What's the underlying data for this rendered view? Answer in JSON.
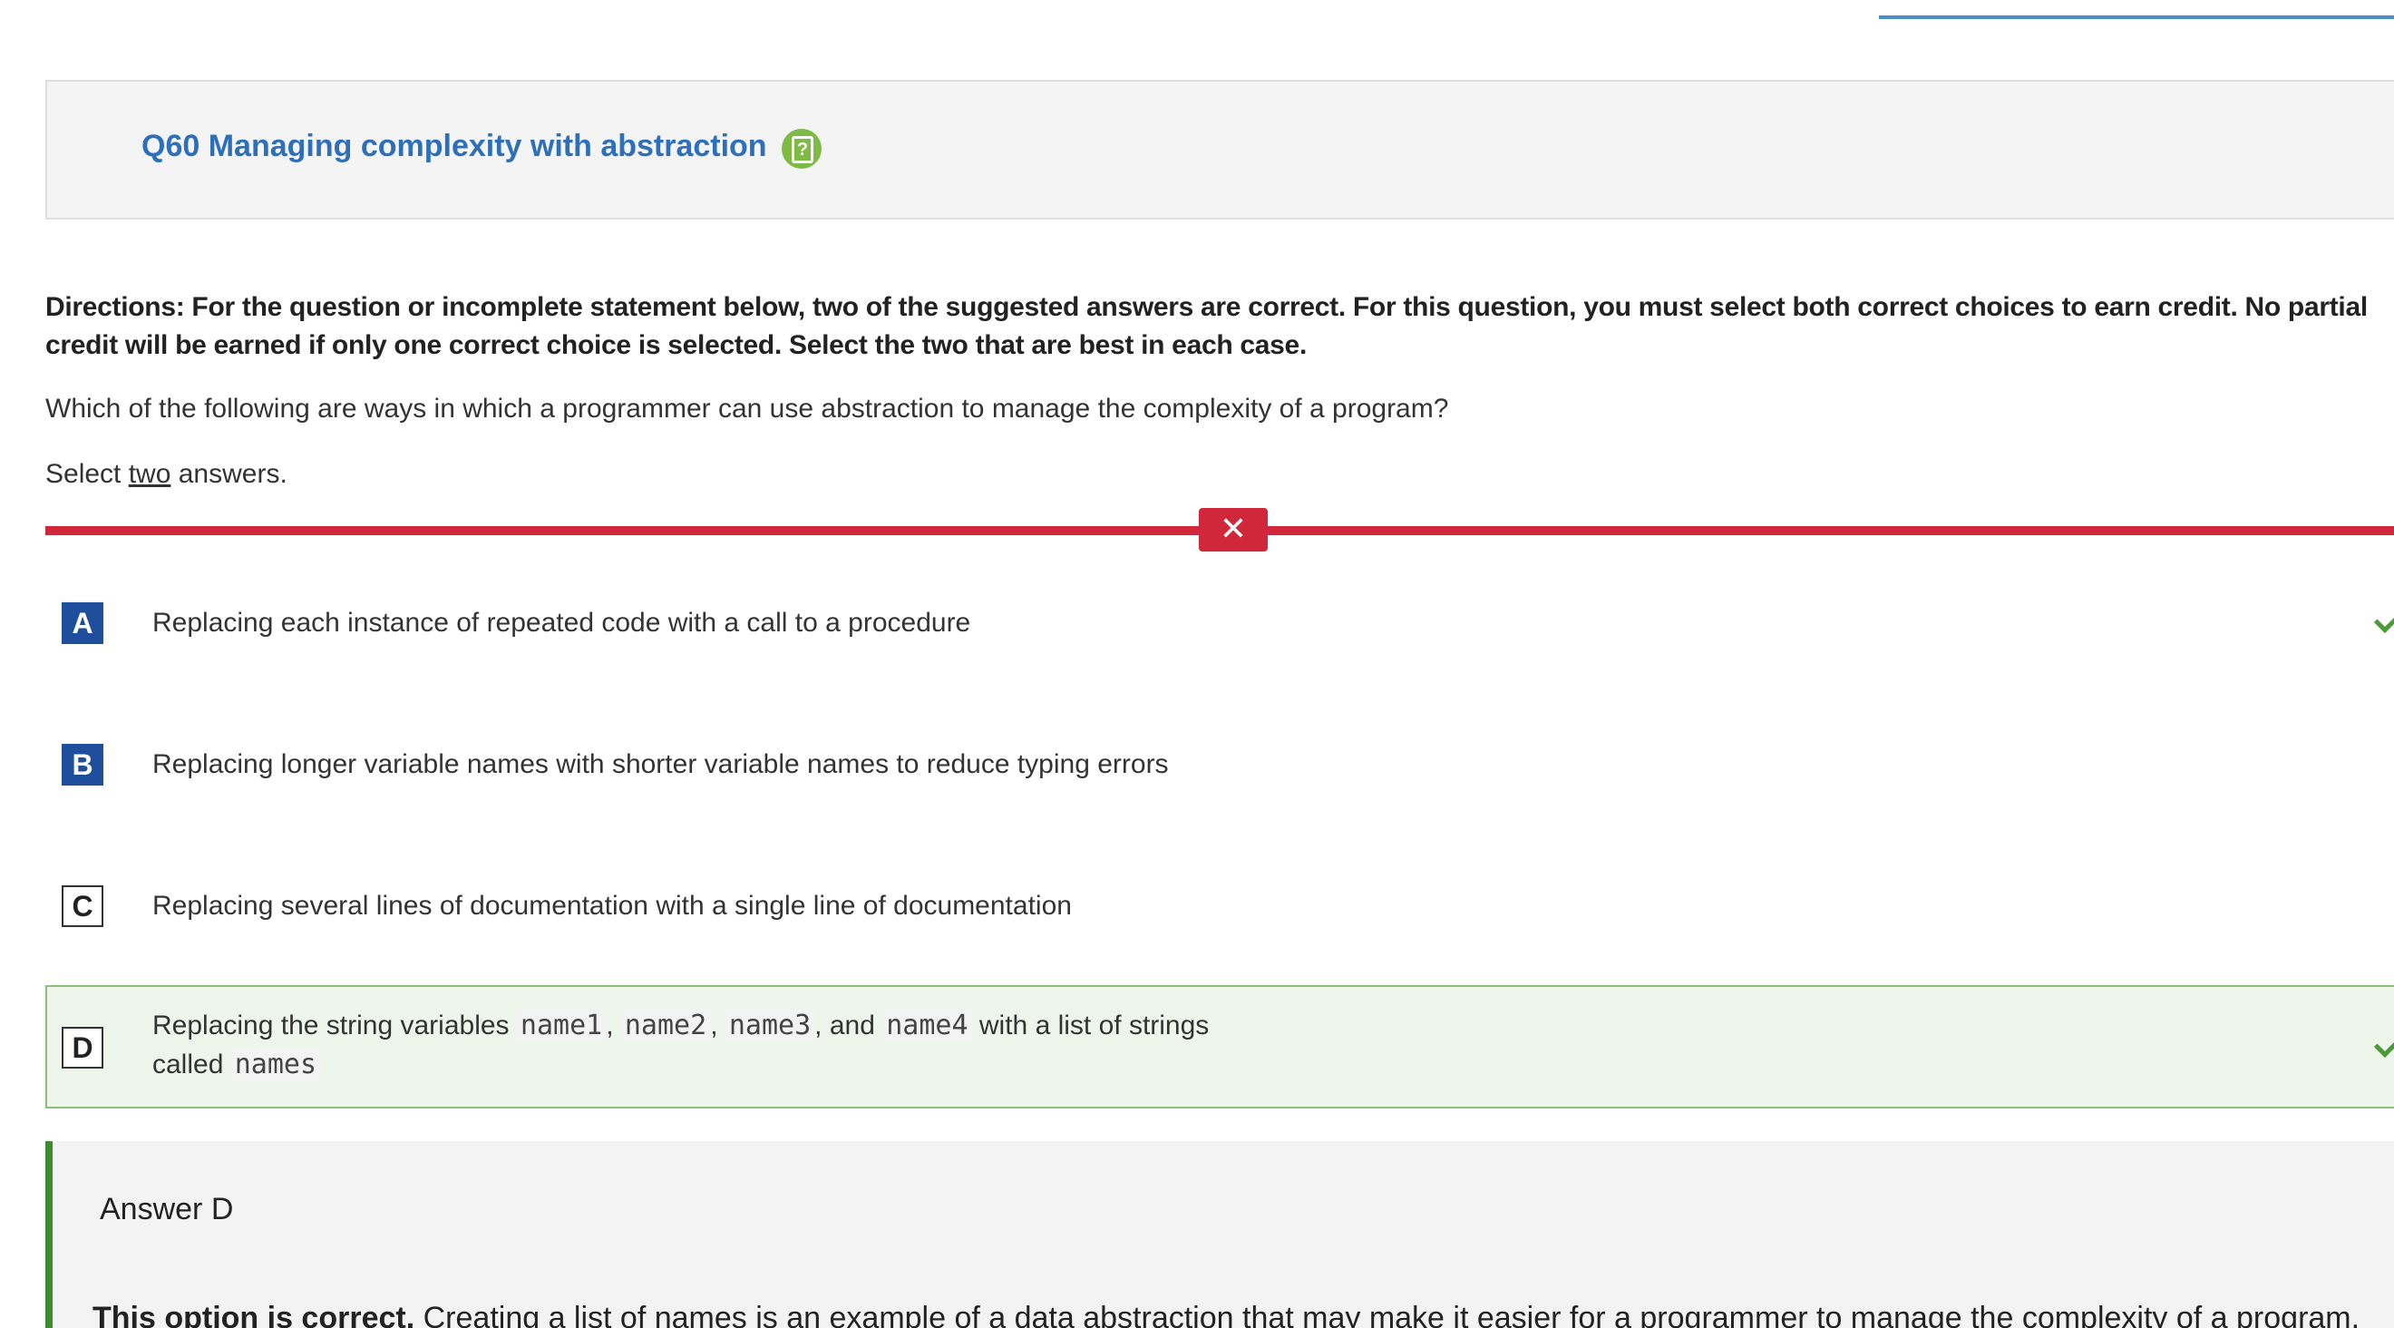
{
  "question": {
    "title": "Q60 Managing complexity with abstraction",
    "help_icon": "help-icon",
    "directions": "Directions: For the question or incomplete statement below, two of the suggested answers are correct. For this question, you must select both correct choices to earn credit. No partial credit will be earned if only one correct choice is selected. Select the two that are best in each case.",
    "prompt": "Which of the following are ways in which a programmer can use abstraction to manage the complexity of a program?",
    "select_prefix": "Select ",
    "select_count": "two",
    "select_suffix": " answers."
  },
  "result": {
    "status": "incorrect",
    "badge_symbol": "✕",
    "color": "#d0283a"
  },
  "choices": [
    {
      "letter": "A",
      "text": "Replacing each instance of repeated code with a call to a procedure",
      "selected": true,
      "correct": true
    },
    {
      "letter": "B",
      "text": "Replacing longer variable names with shorter variable names to reduce typing errors",
      "selected": true,
      "correct": false
    },
    {
      "letter": "C",
      "text": "Replacing several lines of documentation with a single line of documentation",
      "selected": false,
      "correct": false
    },
    {
      "letter": "D",
      "text_part1": "Replacing the string variables ",
      "code1": "name1",
      "sep1": ", ",
      "code2": "name2",
      "sep2": ", ",
      "code3": "name3",
      "sep3": ", and ",
      "code4": "name4",
      "text_part2": " with a list of strings",
      "text_part3": "called ",
      "code5": "names",
      "selected": false,
      "correct": true
    }
  ],
  "answer": {
    "heading": "Answer D",
    "explanation_strong": "This option is correct.",
    "explanation_text": " Creating a list of names is an example of a data abstraction that may make it easier for a programmer to manage the complexity of a program."
  },
  "colors": {
    "title_blue": "#2e6fba",
    "selected_letter": "#1f4e9c",
    "correct_green": "#4a9a3a",
    "help_green": "#7dbb45"
  }
}
